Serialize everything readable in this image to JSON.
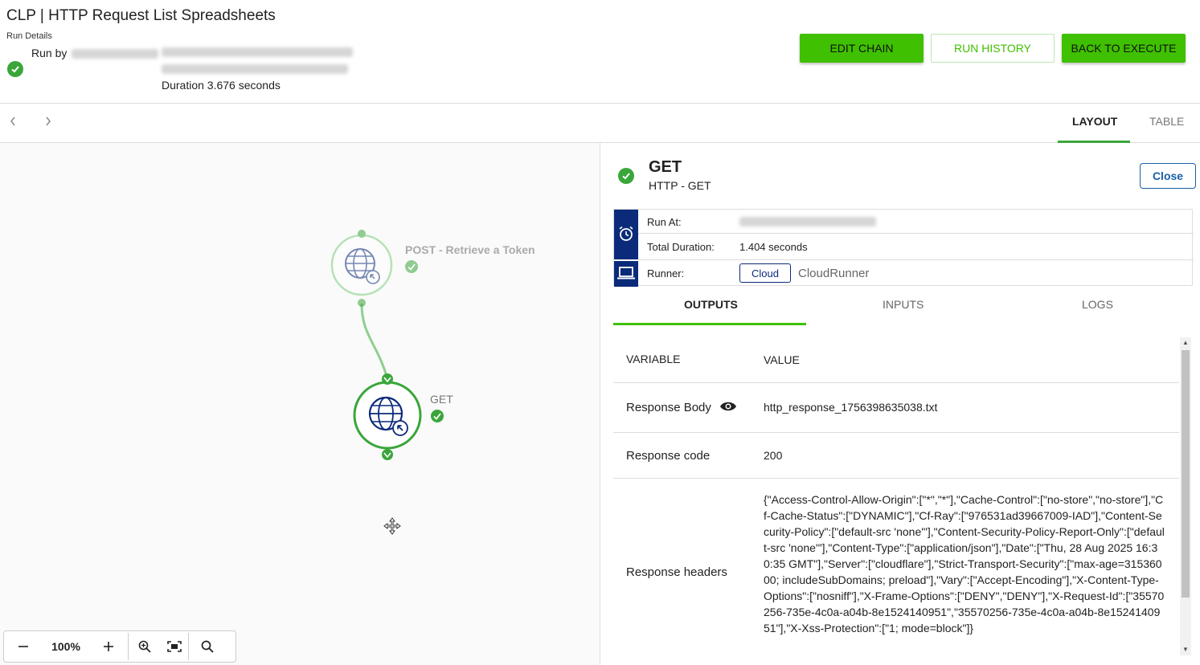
{
  "header": {
    "title": "CLP | HTTP Request List Spreadsheets",
    "run_details_label": "Run Details",
    "run_by_label": "Run by",
    "duration": "Duration 3.676 seconds",
    "buttons": {
      "edit_chain": "EDIT CHAIN",
      "run_history": "RUN HISTORY",
      "back_to_execute": "BACK TO EXECUTE"
    }
  },
  "view_tabs": {
    "layout": "LAYOUT",
    "table": "TABLE",
    "active": "LAYOUT"
  },
  "nav": {
    "prev_icon": "chevron-left-icon",
    "next_icon": "chevron-right-icon"
  },
  "canvas": {
    "nodes": [
      {
        "label": "POST - Retrieve a Token",
        "status": "success",
        "dimmed": true,
        "icon": "globe-icon"
      },
      {
        "label": "GET",
        "status": "success",
        "dimmed": false,
        "icon": "globe-icon"
      }
    ],
    "zoom": {
      "value": "100%",
      "zoom_out_icon": "minus-icon",
      "zoom_in_icon": "plus-icon",
      "magnify_icon": "zoom-in-icon",
      "fit_icon": "fit-screen-icon",
      "search_icon": "search-icon"
    }
  },
  "detail": {
    "title": "GET",
    "subtitle": "HTTP - GET",
    "close_label": "Close",
    "info": {
      "run_at_label": "Run At:",
      "total_duration_label": "Total Duration:",
      "total_duration_value": "1.404 seconds",
      "runner_label": "Runner:",
      "runner_chip": "Cloud",
      "runner_value": "CloudRunner"
    },
    "tabs": {
      "outputs": "OUTPUTS",
      "inputs": "INPUTS",
      "logs": "LOGS",
      "active": "OUTPUTS"
    },
    "table": {
      "headers": {
        "variable": "VARIABLE",
        "value": "VALUE"
      },
      "rows": [
        {
          "variable": "Response Body",
          "value": "http_response_1756398635038.txt"
        },
        {
          "variable": "Response code",
          "value": "200"
        },
        {
          "variable": "Response headers",
          "value": "{\"Access-Control-Allow-Origin\":[\"*\",\"*\"],\"Cache-Control\":[\"no-store\",\"no-store\"],\"Cf-Cache-Status\":[\"DYNAMIC\"],\"Cf-Ray\":[\"976531ad39667009-IAD\"],\"Content-Security-Policy\":[\"default-src 'none'\"],\"Content-Security-Policy-Report-Only\":[\"default-src 'none'\"],\"Content-Type\":[\"application/json\"],\"Date\":[\"Thu, 28 Aug 2025 16:30:35 GMT\"],\"Server\":[\"cloudflare\"],\"Strict-Transport-Security\":[\"max-age=31536000; includeSubDomains; preload\"],\"Vary\":[\"Accept-Encoding\"],\"X-Content-Type-Options\":[\"nosniff\"],\"X-Frame-Options\":[\"DENY\",\"DENY\"],\"X-Request-Id\":[\"35570256-735e-4c0a-a04b-8e1524140951\",\"35570256-735e-4c0a-a04b-8e1524140951\"],\"X-Xss-Protection\":[\"1; mode=block\"]}"
        }
      ]
    }
  },
  "colors": {
    "accent_green": "#3fc000",
    "success_green": "#3aa63a",
    "navy": "#0b2a7a",
    "link_blue": "#1a5fa8"
  }
}
